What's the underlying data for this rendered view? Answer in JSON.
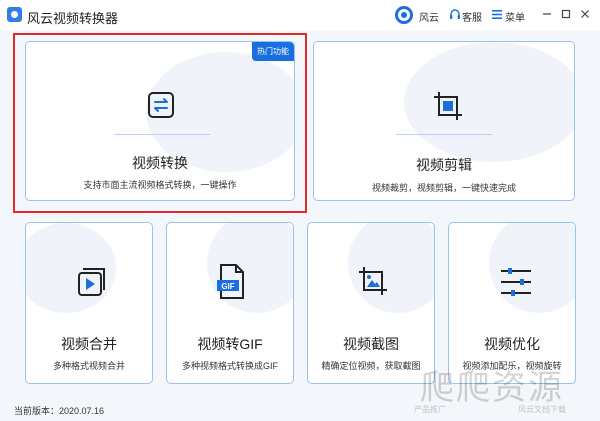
{
  "app": {
    "title": "风云视频转换器"
  },
  "header": {
    "user": "风云",
    "service": "客服",
    "menu": "菜单"
  },
  "features": {
    "convert": {
      "title": "视频转换",
      "desc": "支持市面主流视频格式转换，一键操作",
      "badge": "热门功能"
    },
    "edit": {
      "title": "视频剪辑",
      "desc": "视频裁剪，视频剪辑，一键快速完成"
    },
    "merge": {
      "title": "视频合并",
      "desc": "多种格式视频合并"
    },
    "gif": {
      "title": "视频转GIF",
      "desc": "多种视频格式转换成GIF",
      "icon_text": "GIF"
    },
    "crop": {
      "title": "视频截图",
      "desc": "精确定位视频，获取截图"
    },
    "optimize": {
      "title": "视频优化",
      "desc": "视频添加配乐，视频旋转"
    }
  },
  "footer": {
    "version_label": "当前版本：2020.07.16"
  },
  "watermark": {
    "text": "爬爬资源",
    "left_small": "产品推广",
    "right_small": "风云文档下载"
  },
  "colors": {
    "accent": "#1a6fe0",
    "card_border": "#9cc1ee",
    "highlight": "#e02b2b"
  }
}
